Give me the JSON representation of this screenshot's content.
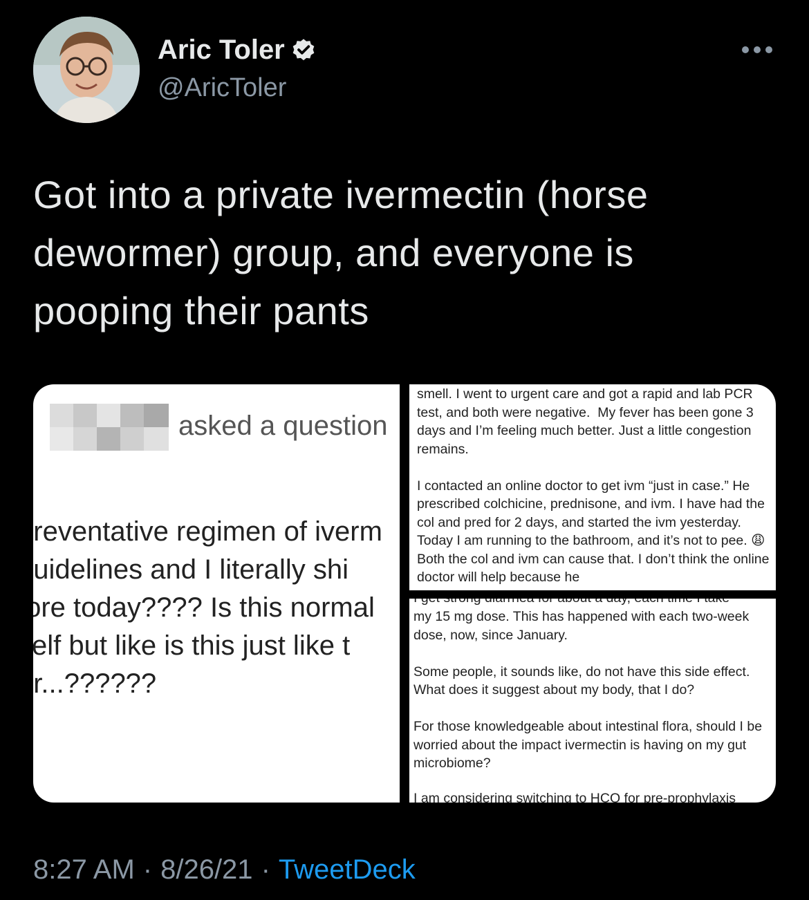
{
  "header": {
    "author_name": "Aric Toler",
    "author_handle": "@AricToler",
    "verified_icon": "verified-badge-icon",
    "more_icon": "more-options-icon"
  },
  "tweet": {
    "text": "Got into a private ivermectin (horse dewormer) group, and everyone is pooping their pants"
  },
  "media": {
    "left_panel": {
      "asked_label": "asked a question",
      "lines": [
        "preventative regimen of iverm",
        "guidelines and I literally shi",
        "tore today???? Is this normal",
        "self but like is this just like t",
        "or...??????"
      ]
    },
    "right_top": {
      "paragraph1": "smell. I went to urgent care and got a rapid and lab PCR test, and both were negative.  My fever has been gone 3 days and I’m feeling much better. Just a little congestion remains.",
      "paragraph2_a": "I contacted an online doctor to get ivm “just in case.” He prescribed colchicine, prednisone, and ivm. I have had the col and pred for 2 days, and started the ivm yesterday. Today I am running to the bathroom, and it’s not to pee.",
      "emoji": "😩",
      "paragraph2_b": "  Both the col and ivm can cause that. I don’t think the online doctor will help because he"
    },
    "right_bottom": {
      "cut_top": "I get strong diarrhea for about a day, each time I take",
      "paragraph1": "my 15 mg dose. This has happened with each two-week dose, now, since January.",
      "paragraph2": "Some people, it sounds like, do not have this side effect. What does it suggest about my body, that I do?",
      "paragraph3": "For those knowledgeable about intestinal flora, should I be worried about the impact ivermectin is having on my gut microbiome?",
      "cut_bottom": "I am considering switching to HCQ for pre-prophylaxis"
    }
  },
  "footer": {
    "time": "8:27 AM",
    "separator1": "·",
    "date": "8/26/21",
    "separator2": "·",
    "source": "TweetDeck"
  },
  "colors": {
    "background": "#000000",
    "text": "#e7e9ea",
    "muted": "#8b98a5",
    "link": "#1d9bf0"
  }
}
